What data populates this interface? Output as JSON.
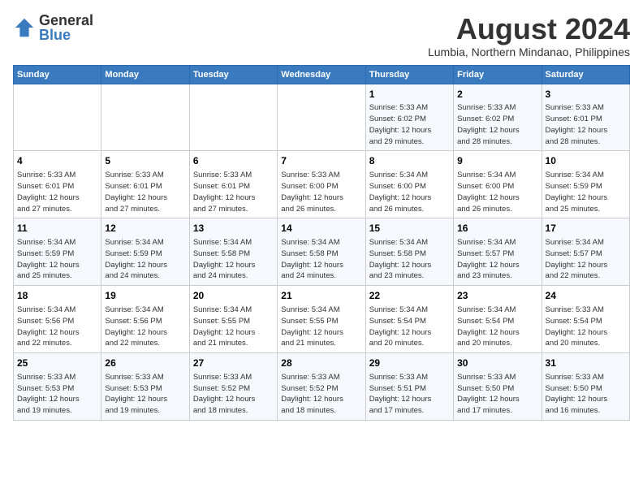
{
  "logo": {
    "general": "General",
    "blue": "Blue"
  },
  "header": {
    "title": "August 2024",
    "subtitle": "Lumbia, Northern Mindanao, Philippines"
  },
  "weekdays": [
    "Sunday",
    "Monday",
    "Tuesday",
    "Wednesday",
    "Thursday",
    "Friday",
    "Saturday"
  ],
  "weeks": [
    [
      {
        "day": "",
        "info": ""
      },
      {
        "day": "",
        "info": ""
      },
      {
        "day": "",
        "info": ""
      },
      {
        "day": "",
        "info": ""
      },
      {
        "day": "1",
        "info": "Sunrise: 5:33 AM\nSunset: 6:02 PM\nDaylight: 12 hours\nand 29 minutes."
      },
      {
        "day": "2",
        "info": "Sunrise: 5:33 AM\nSunset: 6:02 PM\nDaylight: 12 hours\nand 28 minutes."
      },
      {
        "day": "3",
        "info": "Sunrise: 5:33 AM\nSunset: 6:01 PM\nDaylight: 12 hours\nand 28 minutes."
      }
    ],
    [
      {
        "day": "4",
        "info": "Sunrise: 5:33 AM\nSunset: 6:01 PM\nDaylight: 12 hours\nand 27 minutes."
      },
      {
        "day": "5",
        "info": "Sunrise: 5:33 AM\nSunset: 6:01 PM\nDaylight: 12 hours\nand 27 minutes."
      },
      {
        "day": "6",
        "info": "Sunrise: 5:33 AM\nSunset: 6:01 PM\nDaylight: 12 hours\nand 27 minutes."
      },
      {
        "day": "7",
        "info": "Sunrise: 5:33 AM\nSunset: 6:00 PM\nDaylight: 12 hours\nand 26 minutes."
      },
      {
        "day": "8",
        "info": "Sunrise: 5:34 AM\nSunset: 6:00 PM\nDaylight: 12 hours\nand 26 minutes."
      },
      {
        "day": "9",
        "info": "Sunrise: 5:34 AM\nSunset: 6:00 PM\nDaylight: 12 hours\nand 26 minutes."
      },
      {
        "day": "10",
        "info": "Sunrise: 5:34 AM\nSunset: 5:59 PM\nDaylight: 12 hours\nand 25 minutes."
      }
    ],
    [
      {
        "day": "11",
        "info": "Sunrise: 5:34 AM\nSunset: 5:59 PM\nDaylight: 12 hours\nand 25 minutes."
      },
      {
        "day": "12",
        "info": "Sunrise: 5:34 AM\nSunset: 5:59 PM\nDaylight: 12 hours\nand 24 minutes."
      },
      {
        "day": "13",
        "info": "Sunrise: 5:34 AM\nSunset: 5:58 PM\nDaylight: 12 hours\nand 24 minutes."
      },
      {
        "day": "14",
        "info": "Sunrise: 5:34 AM\nSunset: 5:58 PM\nDaylight: 12 hours\nand 24 minutes."
      },
      {
        "day": "15",
        "info": "Sunrise: 5:34 AM\nSunset: 5:58 PM\nDaylight: 12 hours\nand 23 minutes."
      },
      {
        "day": "16",
        "info": "Sunrise: 5:34 AM\nSunset: 5:57 PM\nDaylight: 12 hours\nand 23 minutes."
      },
      {
        "day": "17",
        "info": "Sunrise: 5:34 AM\nSunset: 5:57 PM\nDaylight: 12 hours\nand 22 minutes."
      }
    ],
    [
      {
        "day": "18",
        "info": "Sunrise: 5:34 AM\nSunset: 5:56 PM\nDaylight: 12 hours\nand 22 minutes."
      },
      {
        "day": "19",
        "info": "Sunrise: 5:34 AM\nSunset: 5:56 PM\nDaylight: 12 hours\nand 22 minutes."
      },
      {
        "day": "20",
        "info": "Sunrise: 5:34 AM\nSunset: 5:55 PM\nDaylight: 12 hours\nand 21 minutes."
      },
      {
        "day": "21",
        "info": "Sunrise: 5:34 AM\nSunset: 5:55 PM\nDaylight: 12 hours\nand 21 minutes."
      },
      {
        "day": "22",
        "info": "Sunrise: 5:34 AM\nSunset: 5:54 PM\nDaylight: 12 hours\nand 20 minutes."
      },
      {
        "day": "23",
        "info": "Sunrise: 5:34 AM\nSunset: 5:54 PM\nDaylight: 12 hours\nand 20 minutes."
      },
      {
        "day": "24",
        "info": "Sunrise: 5:33 AM\nSunset: 5:54 PM\nDaylight: 12 hours\nand 20 minutes."
      }
    ],
    [
      {
        "day": "25",
        "info": "Sunrise: 5:33 AM\nSunset: 5:53 PM\nDaylight: 12 hours\nand 19 minutes."
      },
      {
        "day": "26",
        "info": "Sunrise: 5:33 AM\nSunset: 5:53 PM\nDaylight: 12 hours\nand 19 minutes."
      },
      {
        "day": "27",
        "info": "Sunrise: 5:33 AM\nSunset: 5:52 PM\nDaylight: 12 hours\nand 18 minutes."
      },
      {
        "day": "28",
        "info": "Sunrise: 5:33 AM\nSunset: 5:52 PM\nDaylight: 12 hours\nand 18 minutes."
      },
      {
        "day": "29",
        "info": "Sunrise: 5:33 AM\nSunset: 5:51 PM\nDaylight: 12 hours\nand 17 minutes."
      },
      {
        "day": "30",
        "info": "Sunrise: 5:33 AM\nSunset: 5:50 PM\nDaylight: 12 hours\nand 17 minutes."
      },
      {
        "day": "31",
        "info": "Sunrise: 5:33 AM\nSunset: 5:50 PM\nDaylight: 12 hours\nand 16 minutes."
      }
    ]
  ]
}
